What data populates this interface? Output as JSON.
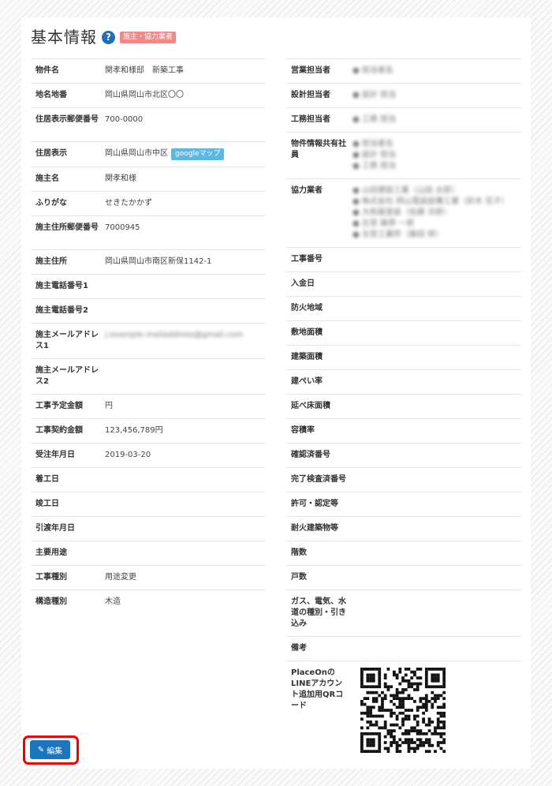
{
  "header": {
    "title": "基本情報",
    "help_icon": "?",
    "badge": "施主・協力業者"
  },
  "left": {
    "rows": [
      {
        "label": "物件名",
        "value": "関孝和様邸　新築工事",
        "h": 29
      },
      {
        "label": "地名地番",
        "value": "岡山県岡山市北区〇〇",
        "h": 29
      },
      {
        "label": "住居表示郵便番号",
        "value": "700-0000",
        "h": 43
      },
      {
        "label": "住居表示",
        "value": "岡山県岡山市中区",
        "h": 29
      },
      {
        "label": "施主名",
        "value": "関孝和様",
        "h": 29
      },
      {
        "label": "ふりがな",
        "value": "せきたかかず",
        "h": 29
      },
      {
        "label": "施主住所郵便番号",
        "value": "7000945",
        "h": 43
      },
      {
        "label": "施主住所",
        "value": "岡山県岡山市南区新保1142-1",
        "h": 29
      },
      {
        "label": "施主電話番号1",
        "value": "",
        "h": 29
      },
      {
        "label": "施主電話番号2",
        "value": "",
        "h": 29
      },
      {
        "label": "施主メールアドレス1",
        "value": "j.example.mailaddress@gmail.com",
        "h": 43
      },
      {
        "label": "施主メールアドレス2",
        "value": "",
        "h": 43
      },
      {
        "label": "工事予定金額",
        "value": "円",
        "h": 29
      },
      {
        "label": "工事契約金額",
        "value": "123,456,789円",
        "h": 29
      },
      {
        "label": "受注年月日",
        "value": "2019-03-20",
        "h": 29
      },
      {
        "label": "着工日",
        "value": "",
        "h": 29
      },
      {
        "label": "竣工日",
        "value": "",
        "h": 29
      },
      {
        "label": "引渡年月日",
        "value": "",
        "h": 29
      },
      {
        "label": "主要用途",
        "value": "",
        "h": 29
      },
      {
        "label": "工事種別",
        "value": "用途変更",
        "h": 29
      },
      {
        "label": "構造種別",
        "value": "木造",
        "h": 29
      }
    ],
    "gmap_label": "googleマップ"
  },
  "right": {
    "rows": [
      {
        "label": "営業担当者",
        "value": [
          "● 担当者名"
        ],
        "blur": true,
        "h": 29
      },
      {
        "label": "設計担当者",
        "value": [
          "● 設計 担当"
        ],
        "blur": true,
        "h": 29
      },
      {
        "label": "工務担当者",
        "value": [
          "● 工務 担当"
        ],
        "blur": true,
        "h": 29
      },
      {
        "label": "物件情報共有社員",
        "value": [
          "● 担当者名",
          "● 設計 担当",
          "● 工務 担当"
        ],
        "blur": true,
        "h": 57
      },
      {
        "label": "協力業者",
        "value": [
          "● 山田建設工業（山田 太郎）",
          "● 株式会社 岡山電設設備工業（鈴木 花子）",
          "● 大和屋塗装（佐藤 次郎）",
          "● 左官 藤原 一郎",
          "● 左官工業所（藤田 修）"
        ],
        "blur": true,
        "h": 85
      },
      {
        "label": "工事番号",
        "value": [],
        "h": 29
      },
      {
        "label": "入金日",
        "value": [],
        "h": 29
      },
      {
        "label": "防火地域",
        "value": [],
        "h": 29
      },
      {
        "label": "敷地面積",
        "value": [],
        "h": 29
      },
      {
        "label": "建築面積",
        "value": [],
        "h": 29
      },
      {
        "label": "建ぺい率",
        "value": [],
        "h": 29
      },
      {
        "label": "延べ床面積",
        "value": [],
        "h": 29
      },
      {
        "label": "容積率",
        "value": [],
        "h": 29
      },
      {
        "label": "確認済番号",
        "value": [],
        "h": 29
      },
      {
        "label": "完了検査済番号",
        "value": [],
        "h": 29
      },
      {
        "label": "許可・認定等",
        "value": [],
        "h": 29
      },
      {
        "label": "耐火建築物等",
        "value": [],
        "h": 29
      },
      {
        "label": "階数",
        "value": [],
        "h": 29
      },
      {
        "label": "戸数",
        "value": [],
        "h": 29
      },
      {
        "label": "ガス、電気、水道の種別・引き込み",
        "value": [],
        "h": 57
      },
      {
        "label": "備考",
        "value": [],
        "h": 29
      },
      {
        "label": "PlaceOnのLINEアカウント追加用QRコード",
        "value": [],
        "qr": true,
        "h": 120
      }
    ]
  },
  "actions": {
    "edit_icon": "pencil-icon",
    "edit_label": "編集"
  },
  "colors": {
    "primary": "#1c74bc",
    "badge": "#ee8a8a",
    "gmap": "#5bb8e6",
    "highlight": "#ee0000"
  }
}
